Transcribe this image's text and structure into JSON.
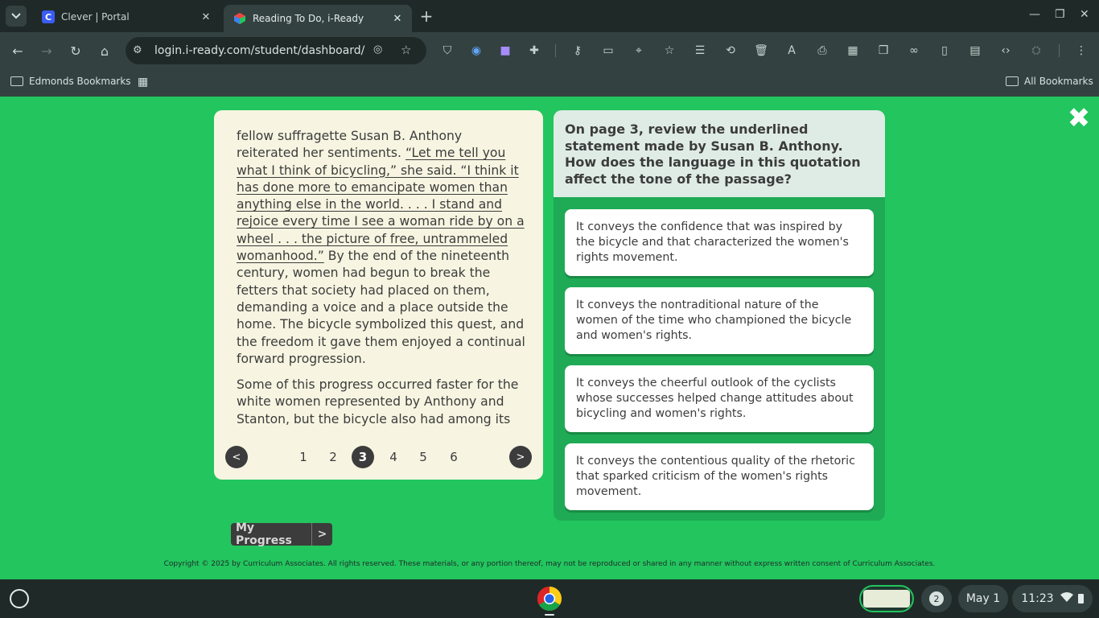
{
  "browser": {
    "tabs": [
      {
        "title": "Clever | Portal",
        "favicon_letter": "C",
        "favicon_color": "#3b5cf5",
        "active": false
      },
      {
        "title": "Reading To Do, i-Ready",
        "favicon_letter": "",
        "favicon_color": "#f59e0b",
        "active": true
      }
    ],
    "url": "login.i-ready.com/student/dashboard/h...",
    "bookmarks_left": "Edmonds Bookmarks",
    "bookmarks_right": "All Bookmarks"
  },
  "passage": {
    "p1_before": "fellow suffragette Susan B. Anthony reiterated her sentiments. ",
    "p1_underlined": "“Let me tell you what I think of bicycling,” she said. “I think it has done more to emancipate women than anything else in the world. . . . I stand and rejoice every time I see a woman ride by on a wheel . . . the picture of free, untrammeled womanhood.”",
    "p1_after": " By the end of the nineteenth century, women had begun to break the fetters that society had placed on them, demanding a voice and a place outside the home. The bicycle symbolized this quest, and the freedom it gave them enjoyed a continual forward progression.",
    "p2": "Some of this progress occurred faster for the white women represented by Anthony and Stanton, but the bicycle also had among its champions brave and capable women of"
  },
  "pager": {
    "prev": "<",
    "next": ">",
    "pages": [
      "1",
      "2",
      "3",
      "4",
      "5",
      "6"
    ],
    "current": "3"
  },
  "question": {
    "prompt": "On page 3, review the underlined statement made by Susan B. Anthony. How does the language in this quotation affect the tone of the passage?",
    "answers": [
      "It conveys the confidence that was inspired by the bicycle and that characterized the women's rights movement.",
      "It conveys the nontraditional nature of the women of the time who championed the bicycle and women's rights.",
      "It conveys the cheerful outlook of the cyclists whose successes helped change attitudes about bicycling and women's rights.",
      "It conveys the contentious quality of the rhetoric that sparked criticism of the women's rights movement."
    ]
  },
  "my_progress": {
    "label": "My Progress",
    "arrow": ">"
  },
  "close_glyph": "✖",
  "copyright": "Copyright © 2025 by Curriculum Associates. All rights reserved. These materials, or any portion thereof, may not be reproduced or shared in any manner without express written consent of Curriculum Associates.",
  "shelf": {
    "notification_count": "2",
    "date": "May 1",
    "time": "11:23"
  },
  "colors": {
    "page_bg": "#22c55e",
    "question_panel": "#1faa55",
    "passage_bg": "#f7f5e1"
  }
}
